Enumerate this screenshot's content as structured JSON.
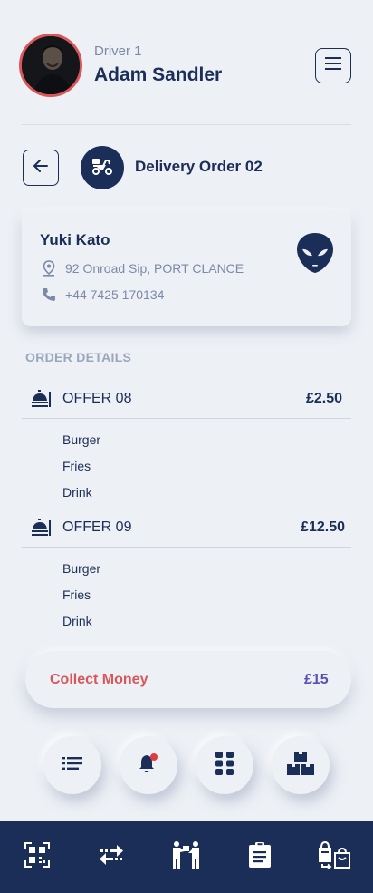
{
  "header": {
    "driver_label": "Driver 1",
    "driver_name": "Adam Sandler",
    "menu_icon": "hamburger-menu-icon"
  },
  "order": {
    "title": "Delivery Order 02",
    "back_icon": "arrow-left-icon",
    "badge_icon": "scooter-icon"
  },
  "customer": {
    "name": "Yuki Kato",
    "address": "92 Onroad Sip, PORT CLANCE",
    "phone": "+44 7425 170134",
    "avatar_icon": "alien-icon"
  },
  "order_details": {
    "label": "ORDER DETAILS",
    "offers": [
      {
        "name": "OFFER 08",
        "price": "£2.50",
        "items": [
          "Burger",
          "Fries",
          "Drink"
        ]
      },
      {
        "name": "OFFER 09",
        "price": "£12.50",
        "items": [
          "Burger",
          "Fries",
          "Drink"
        ]
      }
    ]
  },
  "collect": {
    "label": "Collect Money",
    "amount": "£15"
  },
  "actions": [
    "list-icon",
    "notification-bell-icon",
    "grid-icon",
    "boxes-icon"
  ],
  "bottom_nav": [
    "qr-code-icon",
    "transfer-arrows-icon",
    "handover-icon",
    "clipboard-icon",
    "bag-return-icon"
  ],
  "colors": {
    "background": "#edf0f5",
    "primary": "#1b2e57",
    "accent_red": "#d9575a",
    "accent_purple": "#5a4fb3",
    "muted": "#7c8aa7"
  }
}
